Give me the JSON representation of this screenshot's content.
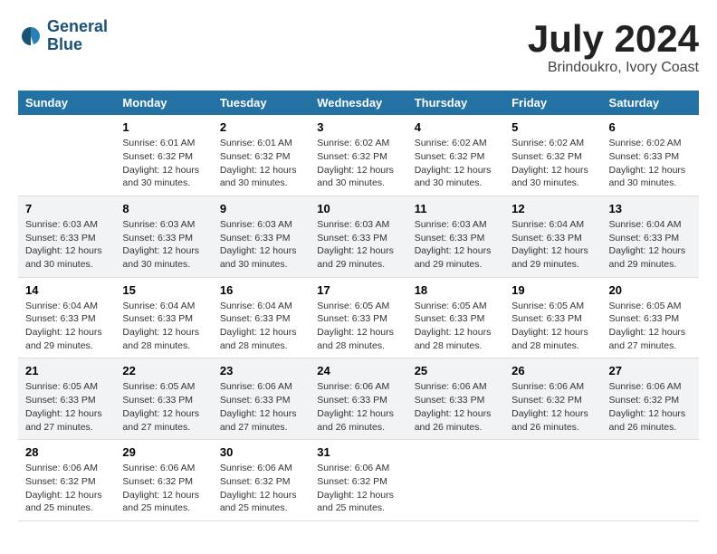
{
  "header": {
    "logo_line1": "General",
    "logo_line2": "Blue",
    "month_title": "July 2024",
    "location": "Brindoukro, Ivory Coast"
  },
  "weekdays": [
    "Sunday",
    "Monday",
    "Tuesday",
    "Wednesday",
    "Thursday",
    "Friday",
    "Saturday"
  ],
  "weeks": [
    [
      {
        "day": "",
        "info": ""
      },
      {
        "day": "1",
        "info": "Sunrise: 6:01 AM\nSunset: 6:32 PM\nDaylight: 12 hours\nand 30 minutes."
      },
      {
        "day": "2",
        "info": "Sunrise: 6:01 AM\nSunset: 6:32 PM\nDaylight: 12 hours\nand 30 minutes."
      },
      {
        "day": "3",
        "info": "Sunrise: 6:02 AM\nSunset: 6:32 PM\nDaylight: 12 hours\nand 30 minutes."
      },
      {
        "day": "4",
        "info": "Sunrise: 6:02 AM\nSunset: 6:32 PM\nDaylight: 12 hours\nand 30 minutes."
      },
      {
        "day": "5",
        "info": "Sunrise: 6:02 AM\nSunset: 6:32 PM\nDaylight: 12 hours\nand 30 minutes."
      },
      {
        "day": "6",
        "info": "Sunrise: 6:02 AM\nSunset: 6:33 PM\nDaylight: 12 hours\nand 30 minutes."
      }
    ],
    [
      {
        "day": "7",
        "info": "Sunrise: 6:03 AM\nSunset: 6:33 PM\nDaylight: 12 hours\nand 30 minutes."
      },
      {
        "day": "8",
        "info": "Sunrise: 6:03 AM\nSunset: 6:33 PM\nDaylight: 12 hours\nand 30 minutes."
      },
      {
        "day": "9",
        "info": "Sunrise: 6:03 AM\nSunset: 6:33 PM\nDaylight: 12 hours\nand 30 minutes."
      },
      {
        "day": "10",
        "info": "Sunrise: 6:03 AM\nSunset: 6:33 PM\nDaylight: 12 hours\nand 29 minutes."
      },
      {
        "day": "11",
        "info": "Sunrise: 6:03 AM\nSunset: 6:33 PM\nDaylight: 12 hours\nand 29 minutes."
      },
      {
        "day": "12",
        "info": "Sunrise: 6:04 AM\nSunset: 6:33 PM\nDaylight: 12 hours\nand 29 minutes."
      },
      {
        "day": "13",
        "info": "Sunrise: 6:04 AM\nSunset: 6:33 PM\nDaylight: 12 hours\nand 29 minutes."
      }
    ],
    [
      {
        "day": "14",
        "info": "Sunrise: 6:04 AM\nSunset: 6:33 PM\nDaylight: 12 hours\nand 29 minutes."
      },
      {
        "day": "15",
        "info": "Sunrise: 6:04 AM\nSunset: 6:33 PM\nDaylight: 12 hours\nand 28 minutes."
      },
      {
        "day": "16",
        "info": "Sunrise: 6:04 AM\nSunset: 6:33 PM\nDaylight: 12 hours\nand 28 minutes."
      },
      {
        "day": "17",
        "info": "Sunrise: 6:05 AM\nSunset: 6:33 PM\nDaylight: 12 hours\nand 28 minutes."
      },
      {
        "day": "18",
        "info": "Sunrise: 6:05 AM\nSunset: 6:33 PM\nDaylight: 12 hours\nand 28 minutes."
      },
      {
        "day": "19",
        "info": "Sunrise: 6:05 AM\nSunset: 6:33 PM\nDaylight: 12 hours\nand 28 minutes."
      },
      {
        "day": "20",
        "info": "Sunrise: 6:05 AM\nSunset: 6:33 PM\nDaylight: 12 hours\nand 27 minutes."
      }
    ],
    [
      {
        "day": "21",
        "info": "Sunrise: 6:05 AM\nSunset: 6:33 PM\nDaylight: 12 hours\nand 27 minutes."
      },
      {
        "day": "22",
        "info": "Sunrise: 6:05 AM\nSunset: 6:33 PM\nDaylight: 12 hours\nand 27 minutes."
      },
      {
        "day": "23",
        "info": "Sunrise: 6:06 AM\nSunset: 6:33 PM\nDaylight: 12 hours\nand 27 minutes."
      },
      {
        "day": "24",
        "info": "Sunrise: 6:06 AM\nSunset: 6:33 PM\nDaylight: 12 hours\nand 26 minutes."
      },
      {
        "day": "25",
        "info": "Sunrise: 6:06 AM\nSunset: 6:33 PM\nDaylight: 12 hours\nand 26 minutes."
      },
      {
        "day": "26",
        "info": "Sunrise: 6:06 AM\nSunset: 6:32 PM\nDaylight: 12 hours\nand 26 minutes."
      },
      {
        "day": "27",
        "info": "Sunrise: 6:06 AM\nSunset: 6:32 PM\nDaylight: 12 hours\nand 26 minutes."
      }
    ],
    [
      {
        "day": "28",
        "info": "Sunrise: 6:06 AM\nSunset: 6:32 PM\nDaylight: 12 hours\nand 25 minutes."
      },
      {
        "day": "29",
        "info": "Sunrise: 6:06 AM\nSunset: 6:32 PM\nDaylight: 12 hours\nand 25 minutes."
      },
      {
        "day": "30",
        "info": "Sunrise: 6:06 AM\nSunset: 6:32 PM\nDaylight: 12 hours\nand 25 minutes."
      },
      {
        "day": "31",
        "info": "Sunrise: 6:06 AM\nSunset: 6:32 PM\nDaylight: 12 hours\nand 25 minutes."
      },
      {
        "day": "",
        "info": ""
      },
      {
        "day": "",
        "info": ""
      },
      {
        "day": "",
        "info": ""
      }
    ]
  ]
}
